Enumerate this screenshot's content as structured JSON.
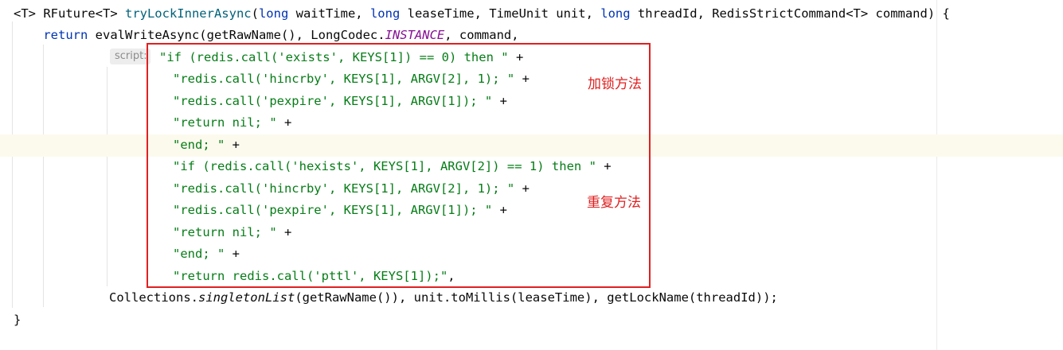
{
  "editor": {
    "param_hint": "script:",
    "lines": [
      {
        "segments": [
          {
            "t": "<T> RFuture<T> ",
            "c": ""
          },
          {
            "t": "tryLockInnerAsync",
            "c": "fn"
          },
          {
            "t": "(",
            "c": ""
          },
          {
            "t": "long",
            "c": "kw"
          },
          {
            "t": " waitTime, ",
            "c": ""
          },
          {
            "t": "long",
            "c": "kw"
          },
          {
            "t": " leaseTime, TimeUnit unit, ",
            "c": ""
          },
          {
            "t": "long",
            "c": "kw"
          },
          {
            "t": " threadId, RedisStrictCommand<T> command) {",
            "c": ""
          }
        ]
      },
      {
        "segments": [
          {
            "t": "    ",
            "c": ""
          },
          {
            "t": "return",
            "c": "kw"
          },
          {
            "t": " evalWriteAsync(getRawName(), LongCodec.",
            "c": ""
          },
          {
            "t": "INSTANCE",
            "c": "const"
          },
          {
            "t": ", command,",
            "c": ""
          }
        ]
      },
      {
        "segments": [
          {
            "t": "\"if (redis.call('exists', KEYS[1]) == 0) then \"",
            "c": "str"
          },
          {
            "t": " +",
            "c": ""
          }
        ]
      },
      {
        "segments": [
          {
            "t": "\"redis.call('hincrby', KEYS[1], ARGV[2], 1); \"",
            "c": "str"
          },
          {
            "t": " +",
            "c": ""
          }
        ]
      },
      {
        "segments": [
          {
            "t": "\"redis.call('pexpire', KEYS[1], ARGV[1]); \"",
            "c": "str"
          },
          {
            "t": " +",
            "c": ""
          }
        ]
      },
      {
        "segments": [
          {
            "t": "\"return nil; \"",
            "c": "str"
          },
          {
            "t": " +",
            "c": ""
          }
        ]
      },
      {
        "segments": [
          {
            "t": "\"end; \"",
            "c": "str"
          },
          {
            "t": " +",
            "c": ""
          }
        ]
      },
      {
        "segments": [
          {
            "t": "\"if (redis.call('hexists', KEYS[1], ARGV[2]) == 1) then \"",
            "c": "str"
          },
          {
            "t": " +",
            "c": ""
          }
        ]
      },
      {
        "segments": [
          {
            "t": "\"redis.call('hincrby', KEYS[1], ARGV[2], 1); \"",
            "c": "str"
          },
          {
            "t": " +",
            "c": ""
          }
        ]
      },
      {
        "segments": [
          {
            "t": "\"redis.call('pexpire', KEYS[1], ARGV[1]); \"",
            "c": "str"
          },
          {
            "t": " +",
            "c": ""
          }
        ]
      },
      {
        "segments": [
          {
            "t": "\"return nil; \"",
            "c": "str"
          },
          {
            "t": " +",
            "c": ""
          }
        ]
      },
      {
        "segments": [
          {
            "t": "\"end; \"",
            "c": "str"
          },
          {
            "t": " +",
            "c": ""
          }
        ]
      },
      {
        "segments": [
          {
            "t": "\"return redis.call('pttl', KEYS[1]);\"",
            "c": "str"
          },
          {
            "t": ",",
            "c": ""
          }
        ]
      },
      {
        "segments": [
          {
            "t": "Collections.",
            "c": ""
          },
          {
            "t": "singletonList",
            "c": "static-call"
          },
          {
            "t": "(getRawName()), unit.toMillis(leaseTime), getLockName(threadId));",
            "c": ""
          }
        ]
      },
      {
        "segments": [
          {
            "t": "}",
            "c": ""
          }
        ]
      }
    ]
  },
  "annotations": {
    "lock_method": "加锁方法",
    "reentrant_method": "重复方法"
  },
  "colors": {
    "keyword": "#0033b3",
    "method_decl": "#00627a",
    "string": "#067d17",
    "constant": "#871094",
    "highlight_box": "#e02020",
    "current_line": "#fcfaed"
  }
}
